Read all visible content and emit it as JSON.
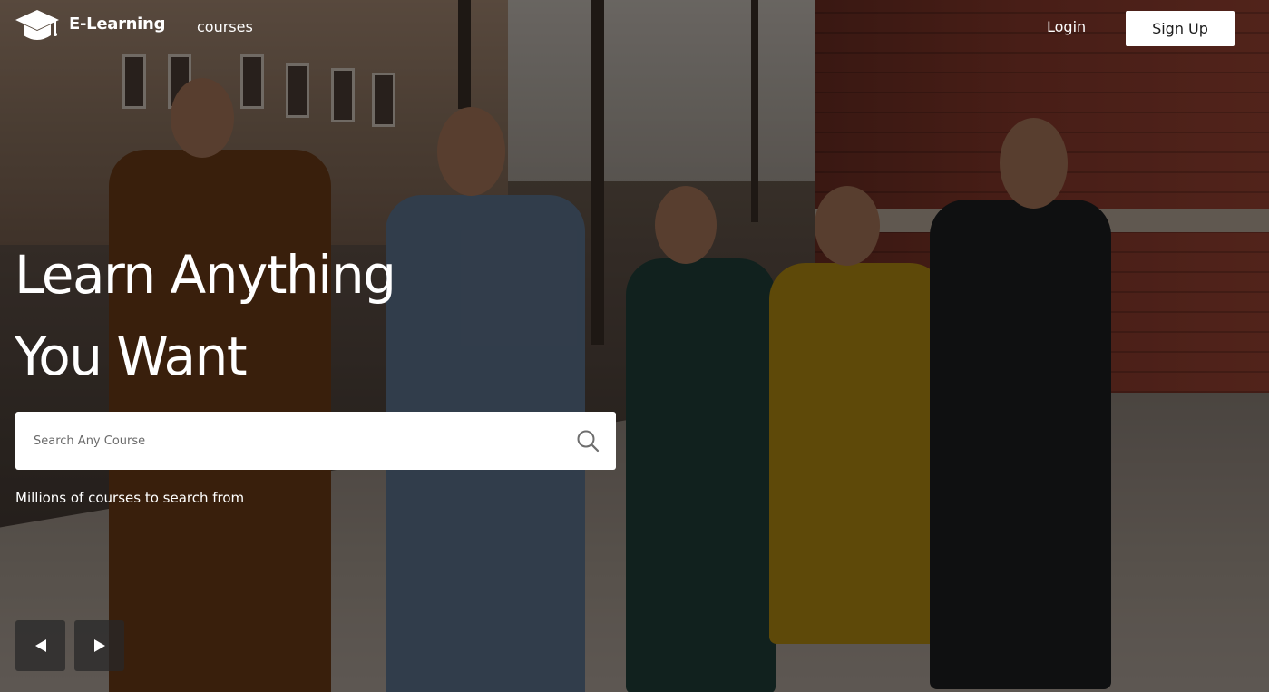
{
  "nav": {
    "brand_name": "E-Learning",
    "brand_icon": "graduation-cap-icon",
    "courses_link": "courses",
    "login_link": "Login",
    "signup_button": "Sign Up"
  },
  "hero": {
    "title_line1": "Learn Anything",
    "title_line2": "You Want",
    "search_placeholder": "Search Any Course",
    "search_icon": "search-icon",
    "subtitle": "Millions of courses to search from"
  },
  "slider": {
    "prev_icon": "arrow-left-icon",
    "next_icon": "arrow-right-icon"
  },
  "colors": {
    "overlay": "#000000",
    "text": "#ffffff",
    "signup_bg": "#ffffff",
    "signup_text": "#1c1c1c"
  }
}
